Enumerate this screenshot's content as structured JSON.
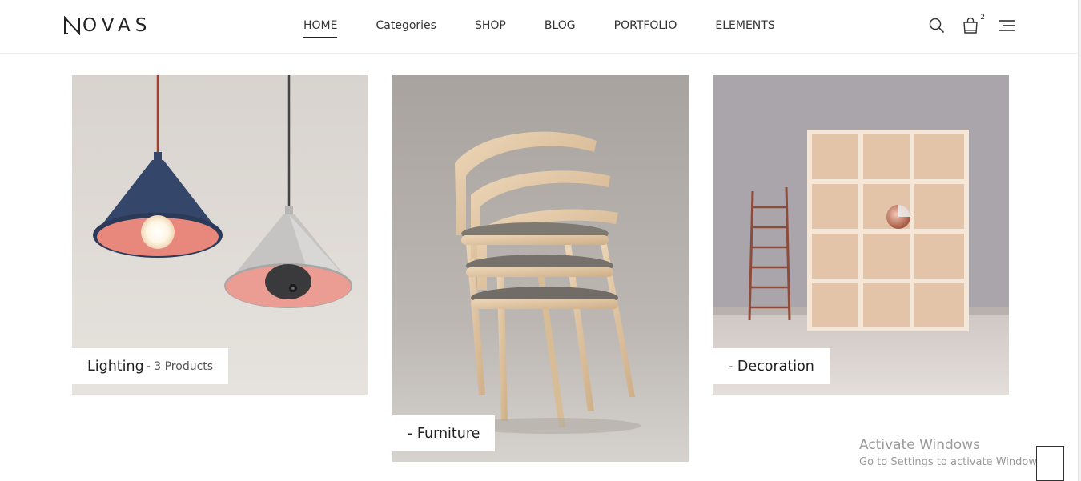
{
  "brand": {
    "logo_text": "OVAS"
  },
  "nav": {
    "items": [
      {
        "label": "HOME",
        "active": true
      },
      {
        "label": "Categories",
        "active": false
      },
      {
        "label": "SHOP",
        "active": false
      },
      {
        "label": "BLOG",
        "active": false
      },
      {
        "label": "PORTFOLIO",
        "active": false
      },
      {
        "label": "ELEMENTS",
        "active": false
      }
    ]
  },
  "header_icons": {
    "search": "search-icon",
    "cart": "shopping-bag-icon",
    "cart_count": "2",
    "menu": "hamburger-menu-icon"
  },
  "categories": [
    {
      "name": "Lighting",
      "count": "- 3 Products",
      "image": "pendant-lamps"
    },
    {
      "name": "- Furniture",
      "count": "",
      "image": "stacked-chairs"
    },
    {
      "name": "- Decoration",
      "count": "",
      "image": "shelf-and-ladder"
    }
  ],
  "watermark": {
    "title": "Activate Windows",
    "subtitle": "Go to Settings to activate Windows."
  },
  "colors": {
    "accent": "#222222",
    "lamp_blue": "#34466a",
    "lamp_pink": "#e8877b",
    "wood": "#e3c9a8"
  }
}
